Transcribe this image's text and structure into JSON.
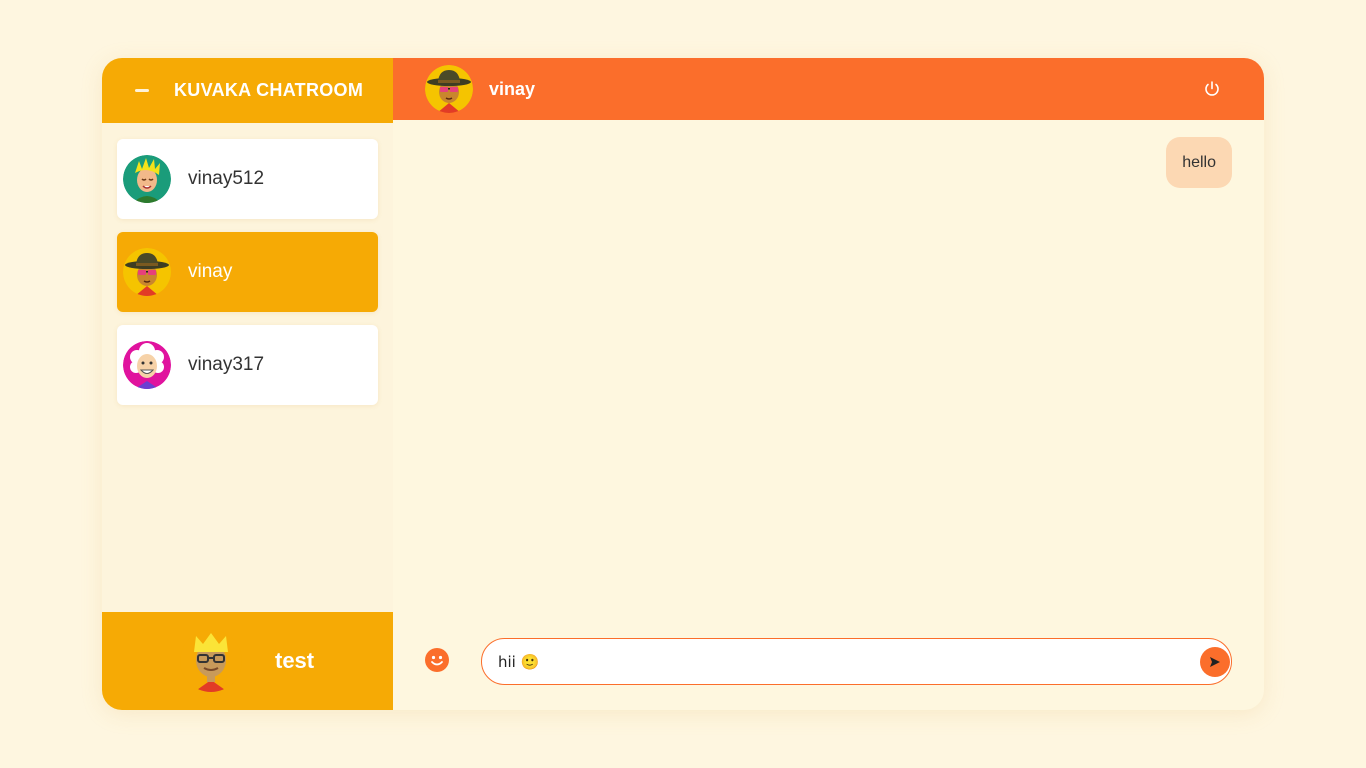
{
  "app": {
    "title": "KUVAKA CHATROOM"
  },
  "contacts": [
    {
      "name": "vinay512",
      "avatar": "spiky-blond-hair-avatar-icon",
      "active": false
    },
    {
      "name": "vinay",
      "avatar": "hat-sunglasses-avatar-icon",
      "active": true
    },
    {
      "name": "vinay317",
      "avatar": "white-hair-smiling-avatar-icon",
      "active": false
    }
  ],
  "current_user": {
    "name": "test",
    "avatar": "crowned-glasses-avatar-icon"
  },
  "chat": {
    "user_name": "vinay",
    "avatar": "hat-sunglasses-avatar-icon",
    "messages": [
      {
        "text": "hello",
        "align": "right"
      }
    ],
    "input_value": "hii 🙂"
  },
  "icons": {
    "logout": "power-icon",
    "emoji": "smiley-icon",
    "send": "send-arrow-icon"
  },
  "colors": {
    "background": "#fef6e0",
    "sidebar_accent": "#f6aa05",
    "header_accent": "#fb6e2b",
    "bubble": "#fcd8b3",
    "text": "#333333",
    "white": "#ffffff"
  }
}
